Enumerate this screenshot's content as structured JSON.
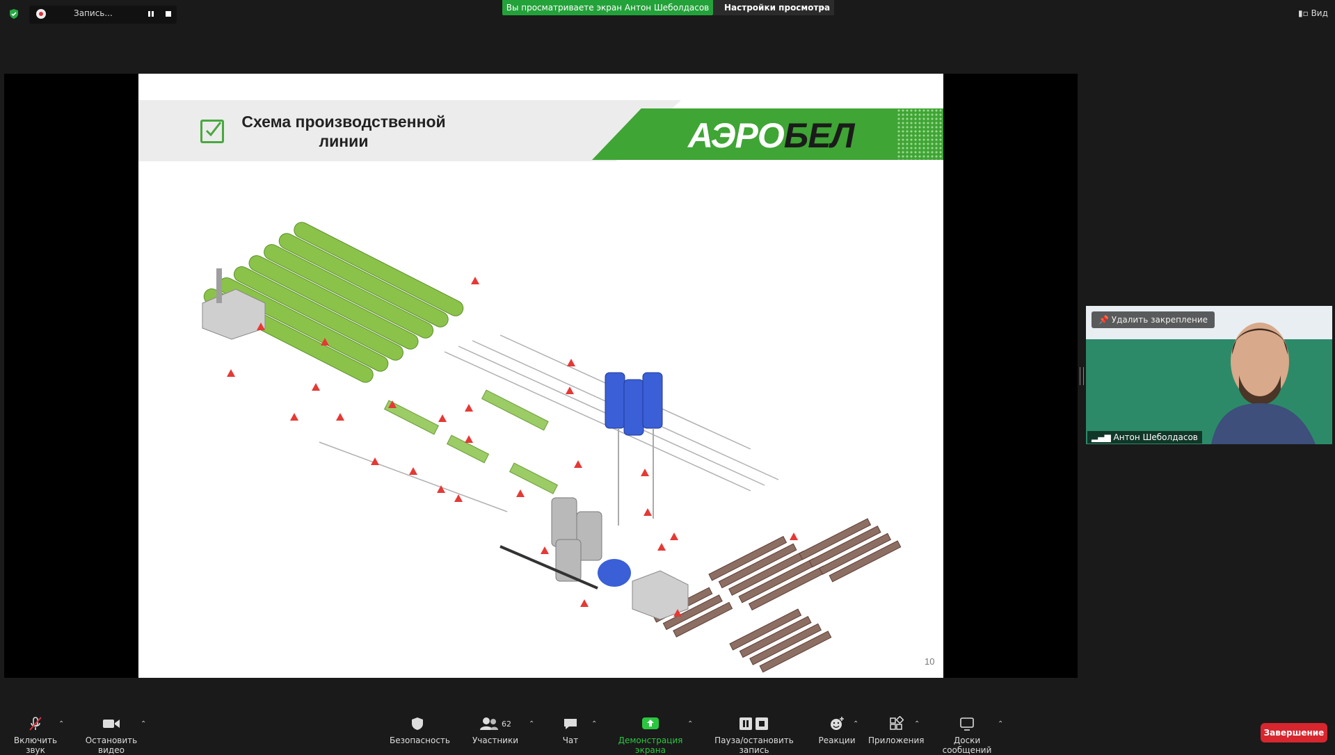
{
  "topbar": {
    "recording_label": "Запись...",
    "banner_viewing": "Вы просматриваете экран Антон Шеболдасов",
    "view_options": "Настройки просмотра",
    "view_button": "Вид"
  },
  "slide": {
    "title": "Схема производственной линии",
    "logo_part1": "АЭРО",
    "logo_part2": "БЕЛ",
    "page_number": "10"
  },
  "video": {
    "unpin_label": "Удалить закрепление",
    "participant_name": "Антон Шеболдасов"
  },
  "toolbar": {
    "unmute": "Включить звук",
    "stop_video": "Остановить видео",
    "security": "Безопасность",
    "participants": "Участники",
    "participants_count": "62",
    "chat": "Чат",
    "share_screen": "Демонстрация экрана",
    "pause_record": "Пауза/остановить запись",
    "reactions": "Реакции",
    "apps": "Приложения",
    "whiteboards": "Доски сообщений",
    "end": "Завершение"
  },
  "colors": {
    "accent_green": "#24a23a",
    "slide_green": "#3fa535",
    "end_red": "#d7262e",
    "background": "#1a1a1a"
  }
}
